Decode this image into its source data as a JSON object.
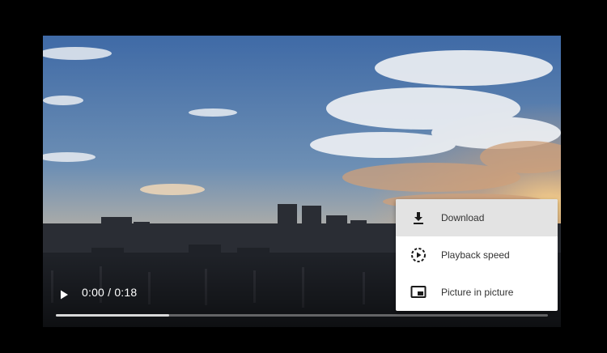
{
  "player": {
    "time_display": "0:00 / 0:18",
    "buffered_fraction": 0.23
  },
  "menu": {
    "items": [
      {
        "label": "Download",
        "icon": "download-icon"
      },
      {
        "label": "Playback speed",
        "icon": "playback-speed-icon"
      },
      {
        "label": "Picture in picture",
        "icon": "picture-in-picture-icon"
      }
    ]
  },
  "colors": {
    "page_background": "#000000",
    "menu_background": "#ffffff",
    "menu_highlight": "#e3e3e3",
    "menu_text": "#333333",
    "control_text": "#ffffff"
  }
}
